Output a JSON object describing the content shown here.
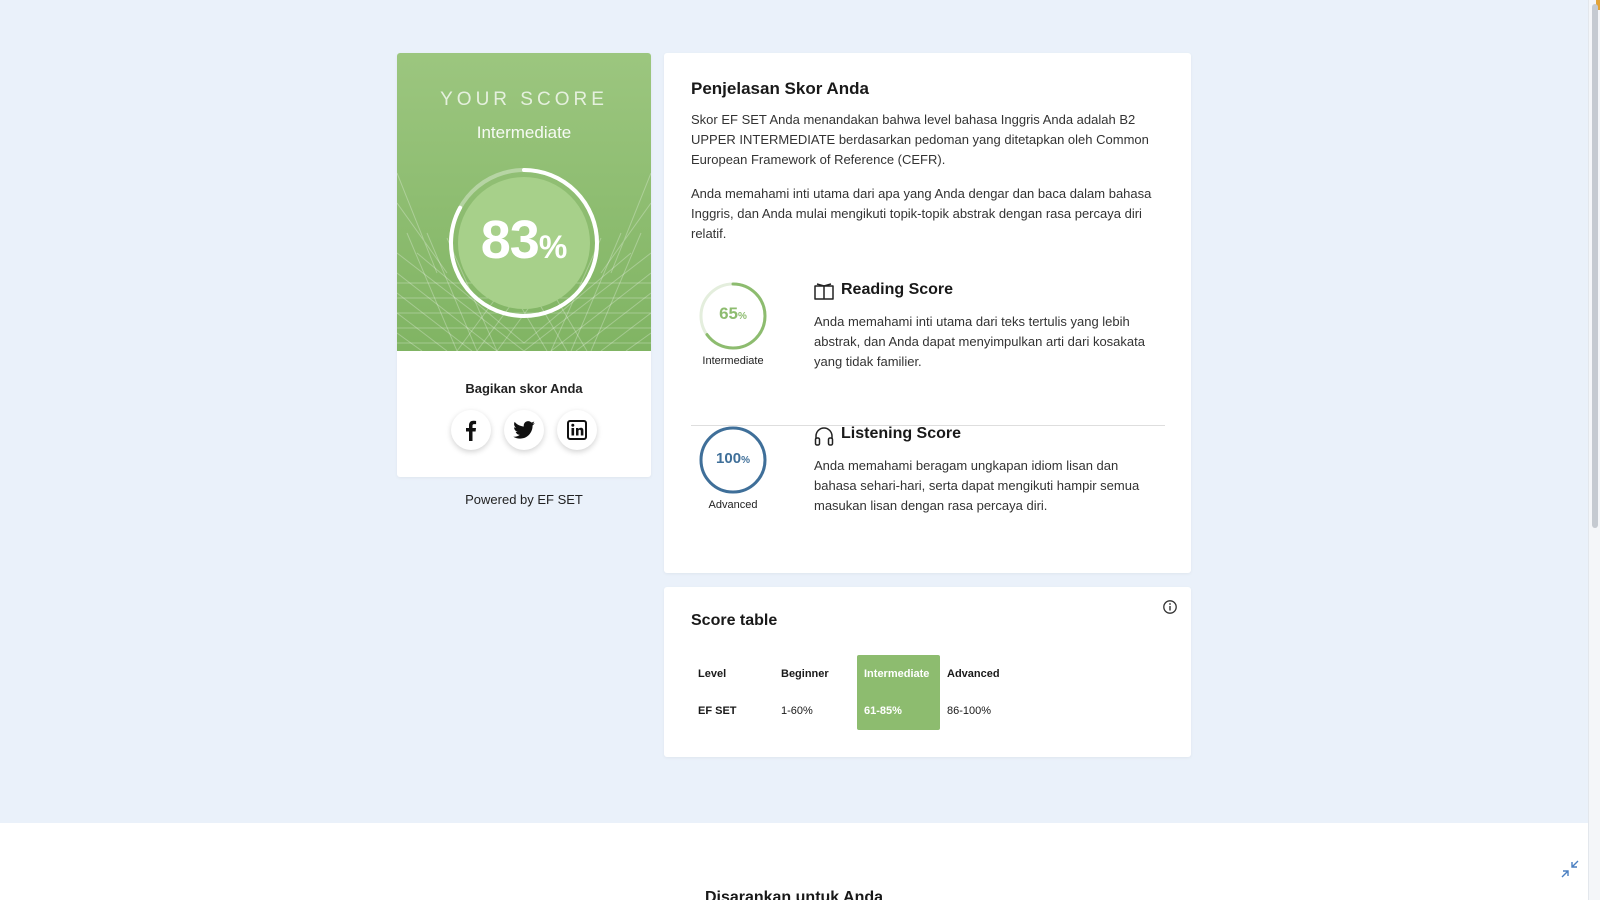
{
  "score_card": {
    "label": "YOUR SCORE",
    "level": "Intermediate",
    "value": "83",
    "value_suffix": "%",
    "progress": 0.83,
    "share_title": "Bagikan skor Anda",
    "share_buttons": [
      {
        "icon": "facebook-icon"
      },
      {
        "icon": "twitter-icon"
      },
      {
        "icon": "linkedin-icon"
      }
    ],
    "powered_by": "Powered by EF SET"
  },
  "explanation": {
    "title": "Penjelasan Skor Anda",
    "paragraph1": "Skor EF SET Anda menandakan bahwa level bahasa Inggris Anda adalah B2 UPPER INTERMEDIATE berdasarkan pedoman yang ditetapkan oleh Common European Framework of Reference (CEFR).",
    "paragraph2": "Anda memahami inti utama dari apa yang Anda dengar dan baca dalam bahasa Inggris, dan Anda mulai mengikuti topik-topik abstrak dengan rasa percaya diri relatif.",
    "reading": {
      "icon": "book-icon",
      "title": "Reading Score",
      "value": "65",
      "suffix": "%",
      "progress": 0.65,
      "level": "Intermediate",
      "color": "#8dbc6f",
      "description": "Anda memahami inti utama dari teks tertulis yang lebih abstrak, dan Anda dapat menyimpulkan arti dari kosakata yang tidak familier."
    },
    "listening": {
      "icon": "headphones-icon",
      "title": "Listening Score",
      "value": "100",
      "suffix": "%",
      "progress": 1.0,
      "level": "Advanced",
      "color": "#3f6f99",
      "description": "Anda memahami beragam ungkapan idiom lisan dan bahasa sehari-hari, serta dapat mengikuti hampir semua masukan lisan dengan rasa percaya diri."
    }
  },
  "score_table": {
    "title": "Score table",
    "info_icon": "info-icon",
    "columns": [
      {
        "header": "Level",
        "value": "EF SET"
      },
      {
        "header": "Beginner",
        "value": "1-60%"
      },
      {
        "header": "Intermediate",
        "value": "61-85%"
      },
      {
        "header": "Advanced",
        "value": "86-100%"
      }
    ],
    "active_column": "Intermediate"
  },
  "bottom": {
    "heading": "Disarankan untuk Anda"
  },
  "colors": {
    "background": "#eaf1fa",
    "accent_green": "#8dbc6f",
    "listening_blue": "#3f6f99"
  }
}
